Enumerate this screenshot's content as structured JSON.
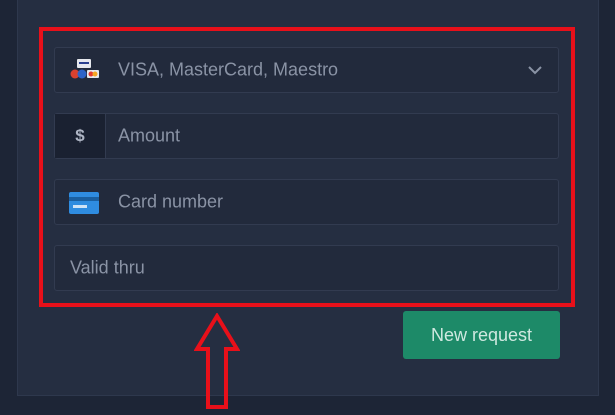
{
  "form": {
    "payment_method": {
      "value": "VISA, MasterCard, Maestro",
      "icon": "card-brands-icon",
      "chevron_icon": "chevron-down-icon"
    },
    "amount": {
      "prefix": "$",
      "placeholder": "Amount"
    },
    "card_number": {
      "placeholder": "Card number",
      "icon": "credit-card-icon"
    },
    "valid_thru": {
      "placeholder": "Valid thru"
    }
  },
  "actions": {
    "new_request_label": "New request"
  },
  "colors": {
    "background": "#1d2536",
    "panel": "#252e41",
    "field": "#222a3c",
    "highlight": "#e8101a",
    "button": "#1d8a68",
    "card_icon": "#2f8ce0"
  }
}
